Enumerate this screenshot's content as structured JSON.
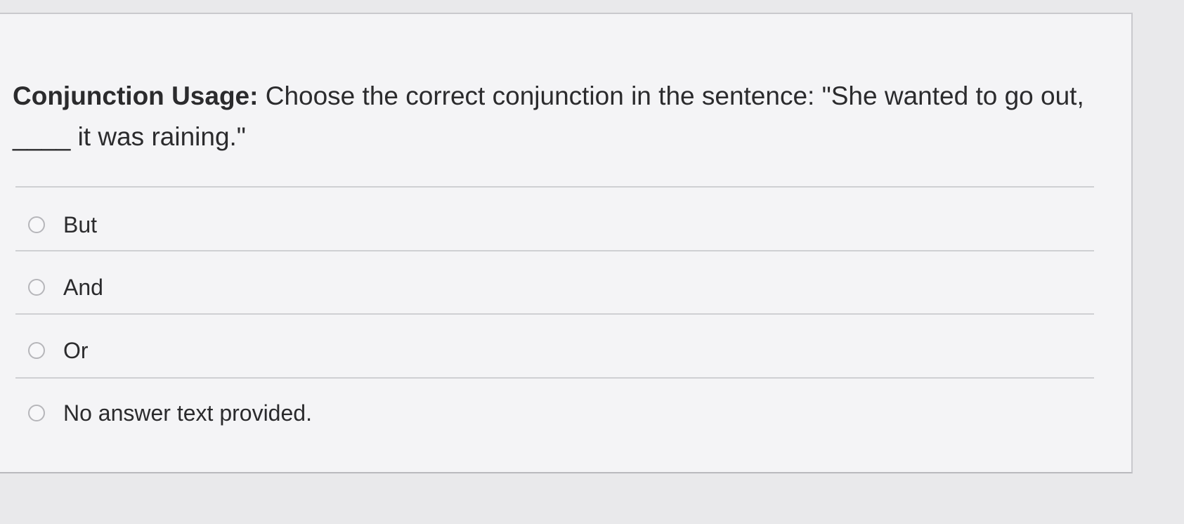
{
  "question": {
    "label": "Conjunction Usage:",
    "text": " Choose the correct conjunction in the sentence: \"She wanted to go out, ____ it was raining.\""
  },
  "options": [
    {
      "label": "But"
    },
    {
      "label": "And"
    },
    {
      "label": "Or"
    },
    {
      "label": "No answer text provided."
    }
  ],
  "colors": {
    "background": "#e9e9eb",
    "panel": "#f4f4f6",
    "text": "#2b2b2d",
    "divider": "#cfd0d3"
  }
}
